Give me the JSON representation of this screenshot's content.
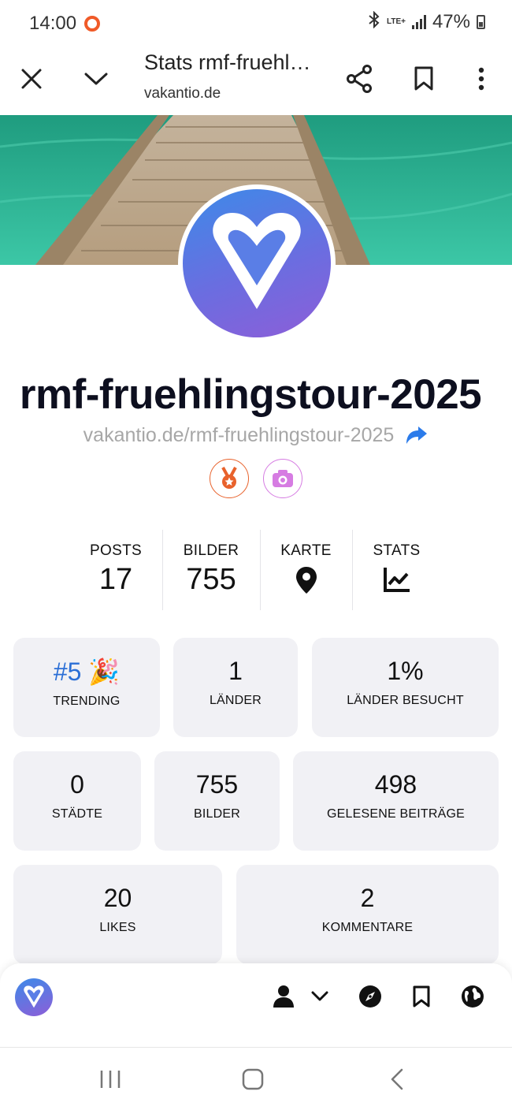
{
  "status_bar": {
    "time": "14:00",
    "network": "LTE+",
    "battery": "47%"
  },
  "toolbar": {
    "title": "Stats rmf-fruehl…",
    "domain": "vakantio.de"
  },
  "profile": {
    "username": "rmf-fruehlingstour-2025",
    "url": "vakantio.de/rmf-fruehlingstour-2025"
  },
  "stats": [
    {
      "label": "POSTS",
      "value": "17"
    },
    {
      "label": "BILDER",
      "value": "755"
    },
    {
      "label": "KARTE",
      "icon": "map-pin-icon"
    },
    {
      "label": "STATS",
      "icon": "chart-line-icon"
    }
  ],
  "cards": [
    {
      "value": "#5",
      "emoji": "🎉",
      "label": "TRENDING"
    },
    {
      "value": "1",
      "label": "LÄNDER"
    },
    {
      "value": "1%",
      "label": "LÄNDER BESUCHT"
    },
    {
      "value": "0",
      "label": "STÄDTE"
    },
    {
      "value": "755",
      "label": "BILDER"
    },
    {
      "value": "498",
      "label": "GELESENE BEITRÄGE"
    },
    {
      "value": "20",
      "label": "LIKES"
    },
    {
      "value": "2",
      "label": "KOMMENTARE"
    }
  ],
  "colors": {
    "accent_blue": "#2b6fd6",
    "logo_gradient_start": "#3d8ae8",
    "logo_gradient_end": "#8d5ed8",
    "medal": "#e8622c",
    "camera": "#d67ce2",
    "card_bg": "#f1f1f5"
  }
}
